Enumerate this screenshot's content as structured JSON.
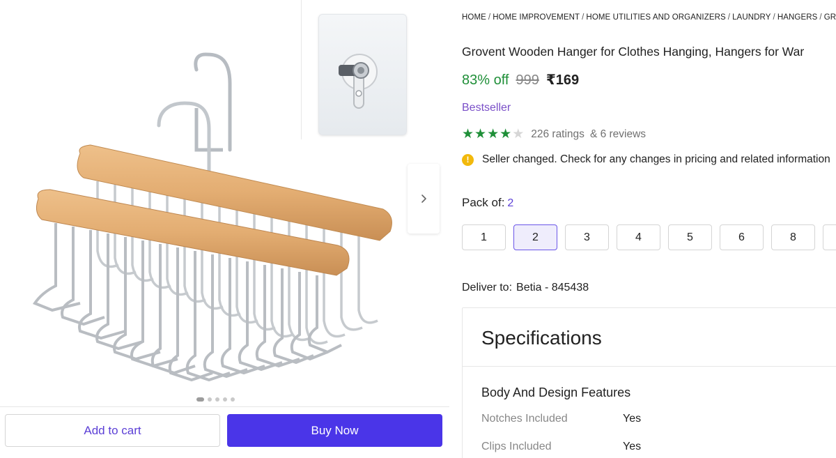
{
  "gallery": {
    "image_dots": 5,
    "active_dot": 0,
    "add_to_cart_label": "Add to cart",
    "buy_now_label": "Buy Now"
  },
  "breadcrumb": [
    "HOME",
    "HOME IMPROVEMENT",
    "HOME UTILITIES AND ORGANIZERS",
    "LAUNDRY",
    "HANGERS",
    "GROV"
  ],
  "product": {
    "title": "Grovent Wooden Hanger for Clothes Hanging, Hangers for War",
    "discount": "83% off",
    "mrp": "999",
    "price": "₹169",
    "badge": "Bestseller",
    "rating_value": 4,
    "rating_max": 5,
    "ratings_text": "226 ratings",
    "reviews_text": "& 6 reviews",
    "notice": "Seller changed. Check for any changes in pricing and related information",
    "pack_label": "Pack of:",
    "pack_selected": "2",
    "pack_options": [
      "1",
      "2",
      "3",
      "4",
      "5",
      "6",
      "8",
      ""
    ],
    "deliver_label": "Deliver to:",
    "deliver_location": "Betia - 845438"
  },
  "specifications": {
    "title": "Specifications",
    "section": "Body And Design Features",
    "rows": [
      {
        "key": "Notches Included",
        "value": "Yes"
      },
      {
        "key": "Clips Included",
        "value": "Yes"
      }
    ]
  },
  "colors": {
    "accent": "#4a35e8",
    "discount_green": "#1f8f38",
    "bestseller_purple": "#7a4fc8",
    "wood": "#e0ad72",
    "steel": "#c9cdd2"
  },
  "icons": {
    "next": "chevron-right-icon",
    "info": "info-icon",
    "star": "star-icon"
  }
}
